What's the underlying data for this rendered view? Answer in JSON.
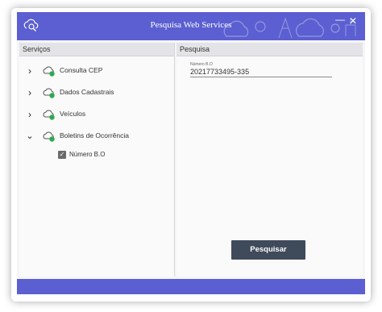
{
  "window": {
    "title": "Pesquisa Web Services"
  },
  "left_pane": {
    "header": "Serviços",
    "items": [
      {
        "label": "Consulta CEP",
        "expanded": false,
        "chevron": "›"
      },
      {
        "label": "Dados Cadastrais",
        "expanded": false,
        "chevron": "›"
      },
      {
        "label": "Veículos",
        "expanded": false,
        "chevron": "›"
      },
      {
        "label": "Boletins de Ocorrência",
        "expanded": true,
        "chevron": "⌄"
      }
    ],
    "sub_items": [
      {
        "label": "Número B.O",
        "checked": true,
        "check_glyph": "✓"
      }
    ]
  },
  "right_pane": {
    "header": "Pesquisa",
    "field": {
      "label": "Número B.O",
      "value": "20217733495-335"
    },
    "search_button": "Pesquisar"
  },
  "titlebar": {
    "minimize_glyph": "—",
    "close_glyph": "✕"
  },
  "colors": {
    "accent": "#5b5fd1",
    "button": "#3f4a5a",
    "service_icon_badge": "#2fa84f"
  }
}
